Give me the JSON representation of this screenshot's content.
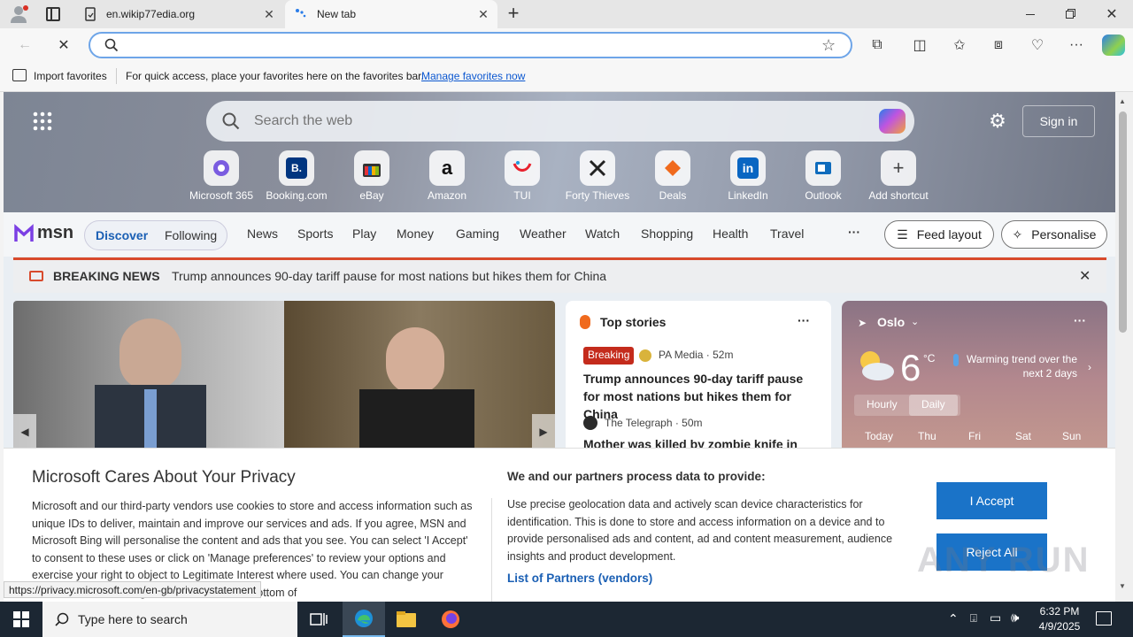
{
  "browser": {
    "tabs": [
      {
        "title": "en.wikip77edia.org"
      },
      {
        "title": "New tab"
      }
    ],
    "address": {
      "value": "",
      "placeholder": ""
    },
    "favorites_bar": {
      "import_label": "Import favorites",
      "hint": "For quick access, place your favorites here on the favorites bar.",
      "manage_link": "Manage favorites now"
    }
  },
  "newtab": {
    "search_placeholder": "Search the web",
    "sign_in": "Sign in",
    "shortcuts": [
      {
        "label": "Microsoft 365",
        "icon": "microsoft365-icon"
      },
      {
        "label": "Booking.com",
        "icon": "B."
      },
      {
        "label": "eBay",
        "icon": "ebay-icon"
      },
      {
        "label": "Amazon",
        "icon": "a"
      },
      {
        "label": "TUI",
        "icon": "tui-icon"
      },
      {
        "label": "Forty Thieves",
        "icon": "swords-icon"
      },
      {
        "label": "Deals",
        "icon": "tag-icon"
      },
      {
        "label": "LinkedIn",
        "icon": "in"
      },
      {
        "label": "Outlook",
        "icon": "outlook-icon"
      },
      {
        "label": "Add shortcut",
        "icon": "+"
      }
    ]
  },
  "msn": {
    "logo": "msn",
    "tabs": [
      "Discover",
      "Following"
    ],
    "nav": [
      "News",
      "Sports",
      "Play",
      "Money",
      "Gaming",
      "Weather",
      "Watch",
      "Shopping",
      "Health",
      "Travel"
    ],
    "more": "···",
    "feed_layout": "Feed layout",
    "personalise": "Personalise",
    "breaking": {
      "label": "BREAKING NEWS",
      "text": "Trump announces 90-day tariff pause for most nations but hikes them for China"
    },
    "top_stories": {
      "title": "Top stories",
      "items": [
        {
          "badge": "Breaking",
          "source": "PA Media · 52m",
          "headline": "Trump announces 90-day tariff pause for most nations but hikes them for China"
        },
        {
          "badge": "",
          "source": "The Telegraph · 50m",
          "headline": "Mother was killed by zombie knife in"
        }
      ]
    },
    "weather": {
      "location": "Oslo",
      "temp": "6",
      "unit": "°C",
      "note": "Warming trend over the next 2 days",
      "modes": [
        "Hourly",
        "Daily"
      ],
      "days": [
        "Today",
        "Thu",
        "Fri",
        "Sat",
        "Sun"
      ]
    }
  },
  "privacy": {
    "title": "Microsoft Cares About Your Privacy",
    "body": "Microsoft and our third-party vendors use cookies to store and access information such as unique IDs to deliver, maintain and improve our services and ads. If you agree, MSN and Microsoft Bing will personalise the content and ads that you see. You can select 'I Accept' to consent to these uses or click on 'Manage preferences' to review your options and exercise your right to object to Legitimate Interest where used. You can change your selection under 'Manage Preferences' at the bottom of",
    "partners_title": "We and our partners process data to provide:",
    "partners_body": "Use precise geolocation data and actively scan device characteristics for identification. This is done to store and access information on a device and to provide personalised ads and content, ad and content measurement, audience insights and product development.",
    "partners_link": "List of Partners (vendors)",
    "accept": "I Accept",
    "reject": "Reject All"
  },
  "status_url": "https://privacy.microsoft.com/en-gb/privacystatement",
  "watermark": "ANY RUN",
  "taskbar": {
    "search_placeholder": "Type here to search",
    "time": "6:32 PM",
    "date": "4/9/2025"
  },
  "colors": {
    "accent": "#1a73c8",
    "breaking_red": "#d84a2c",
    "taskbar": "#1c2733"
  }
}
